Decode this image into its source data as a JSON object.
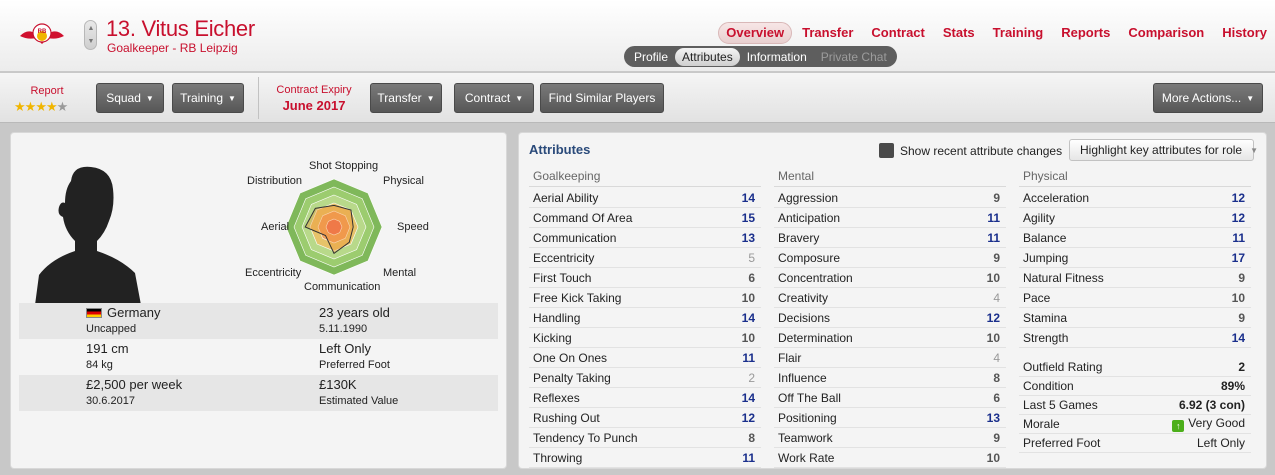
{
  "header": {
    "player_name": "13. Vitus Eicher",
    "player_sub": "Goalkeeper - RB Leipzig",
    "club_badge_text": "RB",
    "nav": [
      "Overview",
      "Transfer",
      "Contract",
      "Stats",
      "Training",
      "Reports",
      "Comparison",
      "History"
    ],
    "nav_active": "Overview",
    "subtabs": [
      "Profile",
      "Attributes",
      "Information",
      "Private Chat"
    ],
    "subtab_active": "Attributes",
    "subtab_disabled": "Private Chat",
    "accent_color": "#c8102e"
  },
  "toolbar": {
    "report_label": "Report",
    "report_stars": 4,
    "report_stars_max": 5,
    "squad": "Squad",
    "training": "Training",
    "contract_expiry_label": "Contract Expiry",
    "contract_expiry": "June 2017",
    "transfer": "Transfer",
    "contract": "Contract",
    "find_similar": "Find Similar Players",
    "more_actions": "More Actions..."
  },
  "profile": {
    "radar_labels": {
      "shot_stopping": "Shot Stopping",
      "physical": "Physical",
      "speed": "Speed",
      "mental": "Mental",
      "communication": "Communication",
      "eccentricity": "Eccentricity",
      "aerial": "Aerial",
      "distribution": "Distribution"
    },
    "radar_values": [
      0.45,
      0.5,
      0.4,
      0.45,
      0.55,
      0.25,
      0.6,
      0.55
    ],
    "nationality": "Germany",
    "caps": "Uncapped",
    "age": "23 years old",
    "dob": "5.11.1990",
    "height": "191 cm",
    "weight": "84 kg",
    "foot": "Left Only",
    "foot_label": "Preferred Foot",
    "wage": "£2,500 per week",
    "contract_end": "30.6.2017",
    "value": "£130K",
    "value_label": "Estimated Value"
  },
  "attributes": {
    "title": "Attributes",
    "show_changes": "Show recent attribute changes",
    "highlight": "Highlight key attributes for role",
    "goalkeeping": {
      "heading": "Goalkeeping",
      "items": [
        {
          "name": "Aerial Ability",
          "value": "14"
        },
        {
          "name": "Command Of Area",
          "value": "15"
        },
        {
          "name": "Communication",
          "value": "13"
        },
        {
          "name": "Eccentricity",
          "value": "5"
        },
        {
          "name": "First Touch",
          "value": "6"
        },
        {
          "name": "Free Kick Taking",
          "value": "10"
        },
        {
          "name": "Handling",
          "value": "14"
        },
        {
          "name": "Kicking",
          "value": "10"
        },
        {
          "name": "One On Ones",
          "value": "11"
        },
        {
          "name": "Penalty Taking",
          "value": "2"
        },
        {
          "name": "Reflexes",
          "value": "14"
        },
        {
          "name": "Rushing Out",
          "value": "12"
        },
        {
          "name": "Tendency To Punch",
          "value": "8"
        },
        {
          "name": "Throwing",
          "value": "11"
        }
      ]
    },
    "mental": {
      "heading": "Mental",
      "items": [
        {
          "name": "Aggression",
          "value": "9"
        },
        {
          "name": "Anticipation",
          "value": "11"
        },
        {
          "name": "Bravery",
          "value": "11"
        },
        {
          "name": "Composure",
          "value": "9"
        },
        {
          "name": "Concentration",
          "value": "10"
        },
        {
          "name": "Creativity",
          "value": "4"
        },
        {
          "name": "Decisions",
          "value": "12"
        },
        {
          "name": "Determination",
          "value": "10"
        },
        {
          "name": "Flair",
          "value": "4"
        },
        {
          "name": "Influence",
          "value": "8"
        },
        {
          "name": "Off The Ball",
          "value": "6"
        },
        {
          "name": "Positioning",
          "value": "13"
        },
        {
          "name": "Teamwork",
          "value": "9"
        },
        {
          "name": "Work Rate",
          "value": "10"
        }
      ]
    },
    "physical": {
      "heading": "Physical",
      "items": [
        {
          "name": "Acceleration",
          "value": "12"
        },
        {
          "name": "Agility",
          "value": "12"
        },
        {
          "name": "Balance",
          "value": "11"
        },
        {
          "name": "Jumping",
          "value": "17"
        },
        {
          "name": "Natural Fitness",
          "value": "9"
        },
        {
          "name": "Pace",
          "value": "10"
        },
        {
          "name": "Stamina",
          "value": "9"
        },
        {
          "name": "Strength",
          "value": "14"
        }
      ]
    },
    "summary": [
      {
        "name": "Outfield Rating",
        "value": "2"
      },
      {
        "name": "Condition",
        "value": "89%"
      },
      {
        "name": "Last 5 Games",
        "value": "6.92 (3 con)"
      },
      {
        "name": "Morale",
        "value": "Very Good"
      },
      {
        "name": "Preferred Foot",
        "value": "Left Only"
      }
    ]
  }
}
